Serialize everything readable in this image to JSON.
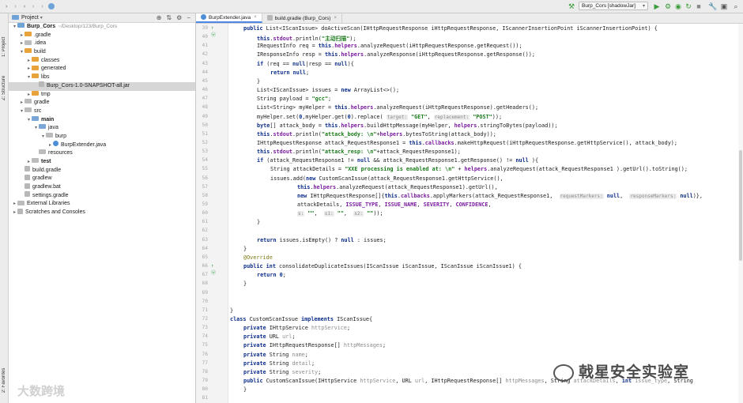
{
  "breadcrumbs": [
    "Burp_Cors",
    "src",
    "main",
    "java",
    "burp",
    "BurpExtender.java"
  ],
  "run_config": "Burp_Cors [shadowJar]",
  "left_strip": {
    "structure": "Z: Structure",
    "project": "1: Project",
    "favorites": "2: Favorites"
  },
  "project_panel": {
    "title": "Project"
  },
  "tree": [
    {
      "label": "Burp_Cors",
      "suffix": "~/Desktop/123/Burp_Cors",
      "indent": 0,
      "arrow": "▾",
      "icon": "folder-src",
      "bold": true
    },
    {
      "label": ".gradle",
      "indent": 1,
      "arrow": "▸",
      "icon": "folder-orange"
    },
    {
      "label": ".idea",
      "indent": 1,
      "arrow": "▸",
      "icon": "folder-grey"
    },
    {
      "label": "build",
      "indent": 1,
      "arrow": "▾",
      "icon": "folder-orange"
    },
    {
      "label": "classes",
      "indent": 2,
      "arrow": "▸",
      "icon": "folder-orange"
    },
    {
      "label": "generated",
      "indent": 2,
      "arrow": "▸",
      "icon": "folder-orange"
    },
    {
      "label": "libs",
      "indent": 2,
      "arrow": "▾",
      "icon": "folder-orange"
    },
    {
      "label": "Burp_Cors-1.0-SNAPSHOT-all.jar",
      "indent": 3,
      "arrow": "",
      "icon": "file-grey",
      "selected": true
    },
    {
      "label": "tmp",
      "indent": 2,
      "arrow": "▸",
      "icon": "folder-orange"
    },
    {
      "label": "gradle",
      "indent": 1,
      "arrow": "▸",
      "icon": "folder-grey"
    },
    {
      "label": "src",
      "indent": 1,
      "arrow": "▾",
      "icon": "folder-grey"
    },
    {
      "label": "main",
      "indent": 2,
      "arrow": "▾",
      "icon": "folder-blue",
      "bold": true
    },
    {
      "label": "java",
      "indent": 3,
      "arrow": "▾",
      "icon": "folder-blue"
    },
    {
      "label": "burp",
      "indent": 4,
      "arrow": "▾",
      "icon": "folder-grey"
    },
    {
      "label": "BurpExtender.java",
      "indent": 5,
      "arrow": "▸",
      "icon": "file-java"
    },
    {
      "label": "resources",
      "indent": 3,
      "arrow": "",
      "icon": "folder-grey"
    },
    {
      "label": "test",
      "indent": 2,
      "arrow": "▸",
      "icon": "folder-grey",
      "bold": true
    },
    {
      "label": "build.gradle",
      "indent": 1,
      "arrow": "",
      "icon": "file-grey"
    },
    {
      "label": "gradlew",
      "indent": 1,
      "arrow": "",
      "icon": "file-grey"
    },
    {
      "label": "gradlew.bat",
      "indent": 1,
      "arrow": "",
      "icon": "file-grey"
    },
    {
      "label": "settings.gradle",
      "indent": 1,
      "arrow": "",
      "icon": "file-grey"
    },
    {
      "label": "External Libraries",
      "indent": 0,
      "arrow": "▸",
      "icon": "library"
    },
    {
      "label": "Scratches and Consoles",
      "indent": 0,
      "arrow": "▸",
      "icon": "scratches"
    }
  ],
  "tabs": [
    {
      "label": "BurpExtender.java",
      "active": true,
      "icon": "java-file-icon"
    },
    {
      "label": "build.gradle (Burp_Cors)",
      "active": false,
      "icon": "gradle-file-icon"
    }
  ],
  "code_lines": [
    {
      "n": "39",
      "g": "↑ ⓦ",
      "i": 1,
      "s": [
        [
          "kw",
          "public "
        ],
        [
          "",
          "List<IScanIssue> doActiveScan(IHttpRequestResponse iHttpRequestResponse, IScannerInsertionPoint iScannerInsertionPoint) {"
        ]
      ]
    },
    {
      "n": "40",
      "g": "",
      "i": 2,
      "s": [
        [
          "kw",
          "this"
        ],
        [
          "",
          "."
        ],
        [
          "fld",
          "stdout"
        ],
        [
          "",
          ".println("
        ],
        [
          "str",
          "\"主动扫描\""
        ],
        [
          "",
          ");"
        ]
      ]
    },
    {
      "n": "41",
      "g": "",
      "i": 2,
      "s": [
        [
          "",
          "IRequestInfo req = "
        ],
        [
          "kw",
          "this"
        ],
        [
          "",
          "."
        ],
        [
          "fld",
          "helpers"
        ],
        [
          "",
          ".analyzeRequest(iHttpRequestResponse.getRequest());"
        ]
      ]
    },
    {
      "n": "42",
      "g": "",
      "i": 2,
      "s": [
        [
          "",
          "IResponseInfo resp = "
        ],
        [
          "kw",
          "this"
        ],
        [
          "",
          "."
        ],
        [
          "fld",
          "helpers"
        ],
        [
          "",
          ".analyzeResponse(iHttpRequestResponse.getResponse());"
        ]
      ]
    },
    {
      "n": "43",
      "g": "",
      "i": 2,
      "s": [
        [
          "kw",
          "if "
        ],
        [
          "",
          "(req == "
        ],
        [
          "kw",
          "null"
        ],
        [
          "",
          "|resp == "
        ],
        [
          "kw",
          "null"
        ],
        [
          "",
          "){"
        ]
      ]
    },
    {
      "n": "44",
      "g": "",
      "i": 3,
      "s": [
        [
          "kw",
          "return null"
        ],
        [
          "",
          ";"
        ]
      ]
    },
    {
      "n": "45",
      "g": "",
      "i": 2,
      "s": [
        [
          "",
          "}"
        ]
      ]
    },
    {
      "n": "46",
      "g": "",
      "i": 2,
      "s": [
        [
          "",
          "List<IScanIssue> issues = "
        ],
        [
          "kw",
          "new "
        ],
        [
          "",
          "ArrayList<>();"
        ]
      ]
    },
    {
      "n": "47",
      "g": "",
      "i": 2,
      "s": [
        [
          "",
          "String payload = "
        ],
        [
          "str",
          "\"gcc\""
        ],
        [
          "",
          ";"
        ]
      ]
    },
    {
      "n": "48",
      "g": "",
      "i": 2,
      "s": [
        [
          "",
          "List<String> myHelper = "
        ],
        [
          "kw",
          "this"
        ],
        [
          "",
          "."
        ],
        [
          "fld",
          "helpers"
        ],
        [
          "",
          ".analyzeRequest(iHttpRequestResponse).getHeaders();"
        ]
      ]
    },
    {
      "n": "49",
      "g": "",
      "i": 2,
      "s": [
        [
          "",
          "myHelper.set("
        ],
        [
          "kw",
          "0"
        ],
        [
          "",
          ",myHelper.get("
        ],
        [
          "kw",
          "0"
        ],
        [
          "",
          ").replace( "
        ],
        [
          "hint",
          "target:"
        ],
        [
          "str",
          " \"GET\""
        ],
        [
          "",
          ", "
        ],
        [
          "hint",
          "replacement:"
        ],
        [
          "str",
          " \"POST\""
        ],
        [
          "",
          "));"
        ]
      ]
    },
    {
      "n": "50",
      "g": "",
      "i": 2,
      "s": [
        [
          "kw",
          "byte"
        ],
        [
          "",
          "[] attack_body = "
        ],
        [
          "kw",
          "this"
        ],
        [
          "",
          "."
        ],
        [
          "fld",
          "helpers"
        ],
        [
          "",
          ".buildHttpMessage(myHelper, "
        ],
        [
          "fld",
          "helpers"
        ],
        [
          "",
          ".stringToBytes(payload));"
        ]
      ]
    },
    {
      "n": "51",
      "g": "",
      "i": 2,
      "s": [
        [
          "kw",
          "this"
        ],
        [
          "",
          "."
        ],
        [
          "fld",
          "stdout"
        ],
        [
          "",
          ".println("
        ],
        [
          "str",
          "\"attack_body: \\n\""
        ],
        [
          "",
          "+"
        ],
        [
          "fld",
          "helpers"
        ],
        [
          "",
          ".bytesToString(attack_body));"
        ]
      ]
    },
    {
      "n": "52",
      "g": "",
      "i": 2,
      "s": [
        [
          "",
          "IHttpRequestResponse attack_RequestResponse1 = "
        ],
        [
          "kw",
          "this"
        ],
        [
          "",
          "."
        ],
        [
          "fld",
          "callbacks"
        ],
        [
          "",
          ".makeHttpRequest(iHttpRequestResponse.getHttpService(), attack_body);"
        ]
      ]
    },
    {
      "n": "53",
      "g": "",
      "i": 2,
      "s": [
        [
          "kw",
          "this"
        ],
        [
          "",
          "."
        ],
        [
          "fld",
          "stdout"
        ],
        [
          "",
          ".println("
        ],
        [
          "str",
          "\"attack_resp: \\n\""
        ],
        [
          "",
          "+attack_RequestResponse1);"
        ]
      ]
    },
    {
      "n": "54",
      "g": "",
      "i": 2,
      "s": [
        [
          "kw",
          "if "
        ],
        [
          "",
          "(attack_RequestResponse1 != "
        ],
        [
          "kw",
          "null "
        ],
        [
          "",
          "&& attack_RequestResponse1.getResponse() != "
        ],
        [
          "kw",
          "null "
        ],
        [
          "",
          "){"
        ]
      ]
    },
    {
      "n": "55",
      "g": "",
      "i": 3,
      "s": [
        [
          "",
          "String attackDetails = "
        ],
        [
          "str",
          "\"XXE processing is enabled at: \\n\""
        ],
        [
          "",
          " + "
        ],
        [
          "fld",
          "helpers"
        ],
        [
          "",
          ".analyzeRequest(attack_RequestResponse1 ).getUrl().toString();"
        ]
      ]
    },
    {
      "n": "56",
      "g": "",
      "i": 3,
      "s": [
        [
          "",
          "issues.add("
        ],
        [
          "kw",
          "new "
        ],
        [
          "",
          "CustomScanIssue(attack_RequestResponse1.getHttpService(),"
        ]
      ]
    },
    {
      "n": "57",
      "g": "",
      "i": 5,
      "s": [
        [
          "kw",
          "this"
        ],
        [
          "",
          "."
        ],
        [
          "fld",
          "helpers"
        ],
        [
          "",
          ".analyzeRequest(attack_RequestResponse1).getUrl(),"
        ]
      ]
    },
    {
      "n": "58",
      "g": "",
      "i": 5,
      "s": [
        [
          "kw",
          "new "
        ],
        [
          "",
          "IHttpRequestResponse[]{"
        ],
        [
          "kw",
          "this"
        ],
        [
          "",
          "."
        ],
        [
          "fld",
          "callbacks"
        ],
        [
          "",
          ".applyMarkers(attack_RequestResponse1,  "
        ],
        [
          "hint",
          "requestMarkers:"
        ],
        [
          "kw",
          " null"
        ],
        [
          "",
          ",  "
        ],
        [
          "hint",
          "responseMarkers:"
        ],
        [
          "kw",
          " null"
        ],
        [
          "",
          ")},"
        ]
      ]
    },
    {
      "n": "59",
      "g": "",
      "i": 5,
      "s": [
        [
          "",
          "attackDetails, "
        ],
        [
          "fld",
          "ISSUE_TYPE"
        ],
        [
          "",
          ", "
        ],
        [
          "fld",
          "ISSUE_NAME"
        ],
        [
          "",
          ", "
        ],
        [
          "fld",
          "SEVERITY"
        ],
        [
          "",
          ", "
        ],
        [
          "fld",
          "CONFIDENCE"
        ],
        [
          "",
          ","
        ]
      ]
    },
    {
      "n": "60",
      "g": "",
      "i": 5,
      "s": [
        [
          "hint",
          "s:"
        ],
        [
          "str",
          " \"\""
        ],
        [
          "",
          ",  "
        ],
        [
          "hint",
          "s1:"
        ],
        [
          "str",
          " \"\""
        ],
        [
          "",
          ",  "
        ],
        [
          "hint",
          "s2:"
        ],
        [
          "str",
          " \"\""
        ],
        [
          "",
          "));"
        ]
      ]
    },
    {
      "n": "61",
      "g": "",
      "i": 2,
      "s": [
        [
          "",
          "}"
        ]
      ]
    },
    {
      "n": "62",
      "g": "",
      "i": 2,
      "s": [
        [
          "",
          ""
        ]
      ]
    },
    {
      "n": "63",
      "g": "",
      "i": 2,
      "s": [
        [
          "kw",
          "return "
        ],
        [
          "",
          "issues.isEmpty() ? "
        ],
        [
          "kw",
          "null"
        ],
        [
          "",
          " : issues;"
        ]
      ]
    },
    {
      "n": "64",
      "g": "",
      "i": 1,
      "s": [
        [
          "",
          "}"
        ]
      ]
    },
    {
      "n": "65",
      "g": "",
      "i": 1,
      "s": [
        [
          "ann",
          "@Override"
        ]
      ]
    },
    {
      "n": "66",
      "g": "↑ ⓦ",
      "i": 1,
      "s": [
        [
          "kw",
          "public int "
        ],
        [
          "",
          "consolidateDuplicateIssues(IScanIssue iScanIssue, IScanIssue iScanIssue1) {"
        ]
      ]
    },
    {
      "n": "67",
      "g": "",
      "i": 2,
      "s": [
        [
          "kw",
          "return 0"
        ],
        [
          "",
          ";"
        ]
      ]
    },
    {
      "n": "68",
      "g": "",
      "i": 1,
      "s": [
        [
          "",
          "}"
        ]
      ]
    },
    {
      "n": "69",
      "g": "",
      "i": 0,
      "s": [
        [
          "",
          ""
        ]
      ]
    },
    {
      "n": "70",
      "g": "",
      "i": 0,
      "s": [
        [
          "",
          ""
        ]
      ]
    },
    {
      "n": "71",
      "g": "",
      "i": 0,
      "s": [
        [
          "",
          "}"
        ]
      ]
    },
    {
      "n": "72",
      "g": "",
      "i": 0,
      "s": [
        [
          "kw",
          "class "
        ],
        [
          "",
          "CustomScanIssue "
        ],
        [
          "kw",
          "implements "
        ],
        [
          "",
          "IScanIssue{"
        ]
      ]
    },
    {
      "n": "73",
      "g": "",
      "i": 1,
      "s": [
        [
          "kw",
          "private "
        ],
        [
          "",
          "IHttpService "
        ],
        [
          "prm",
          "httpService"
        ],
        [
          "",
          ";"
        ]
      ]
    },
    {
      "n": "74",
      "g": "",
      "i": 1,
      "s": [
        [
          "kw",
          "private "
        ],
        [
          "",
          "URL "
        ],
        [
          "prm",
          "url"
        ],
        [
          "",
          ";"
        ]
      ]
    },
    {
      "n": "75",
      "g": "",
      "i": 1,
      "s": [
        [
          "kw",
          "private "
        ],
        [
          "",
          "IHttpRequestResponse[] "
        ],
        [
          "prm",
          "httpMessages"
        ],
        [
          "",
          ";"
        ]
      ]
    },
    {
      "n": "76",
      "g": "",
      "i": 1,
      "s": [
        [
          "kw",
          "private "
        ],
        [
          "",
          "String "
        ],
        [
          "prm",
          "name"
        ],
        [
          "",
          ";"
        ]
      ]
    },
    {
      "n": "77",
      "g": "",
      "i": 1,
      "s": [
        [
          "kw",
          "private "
        ],
        [
          "",
          "String "
        ],
        [
          "prm",
          "detail"
        ],
        [
          "",
          ";"
        ]
      ]
    },
    {
      "n": "78",
      "g": "",
      "i": 1,
      "s": [
        [
          "kw",
          "private "
        ],
        [
          "",
          "String "
        ],
        [
          "prm",
          "severity"
        ],
        [
          "",
          ";"
        ]
      ]
    },
    {
      "n": "79",
      "g": "",
      "i": 1,
      "s": [
        [
          "kw",
          "public "
        ],
        [
          "",
          "CustomScanIssue(IHttpService "
        ],
        [
          "prm",
          "httpService"
        ],
        [
          "",
          ", URL "
        ],
        [
          "prm",
          "url"
        ],
        [
          "",
          ", IHttpRequestResponse[] "
        ],
        [
          "prm",
          "httpMessages"
        ],
        [
          "",
          ", String "
        ],
        [
          "prm",
          "attackDetails"
        ],
        [
          "",
          ", "
        ],
        [
          "kw",
          "int "
        ],
        [
          "prm",
          "issue_type"
        ],
        [
          "",
          ", String"
        ]
      ]
    },
    {
      "n": "80",
      "g": "",
      "i": 1,
      "s": [
        [
          "",
          "}"
        ]
      ]
    },
    {
      "n": "81",
      "g": "",
      "i": 0,
      "s": [
        [
          "",
          ""
        ]
      ]
    }
  ],
  "watermarks": {
    "left": "大数跨境",
    "right": "戟星安全实验室"
  },
  "colors": {
    "keyword": "#0c2e8a",
    "field": "#7a1c9e",
    "string": "#1a7a1a",
    "annotation": "#7e7a14",
    "param": "#8c8c8c",
    "tab_accent": "#4e88e6"
  }
}
